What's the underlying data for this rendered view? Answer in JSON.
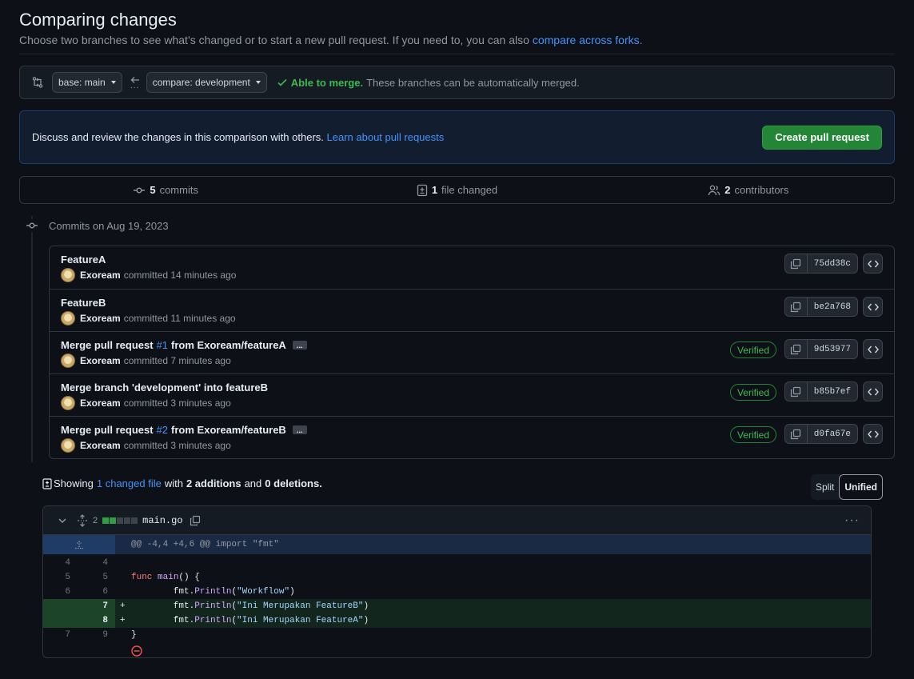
{
  "header": {
    "title": "Comparing changes",
    "subtitle": "Choose two branches to see what’s changed or to start a new pull request. If you need to, you can also",
    "subtitle_link": "compare across forks."
  },
  "range": {
    "base_label": "base: main",
    "compare_label": "compare: development",
    "merge_ok": "Able to merge.",
    "merge_desc": "These branches can be automatically merged."
  },
  "discuss": {
    "text": "Discuss and review the changes in this comparison with others.",
    "link": "Learn about pull requests",
    "button": "Create pull request"
  },
  "summary": {
    "commits_count": "5",
    "commits_label": "commits",
    "files_count": "1",
    "files_label": "file changed",
    "contributors_count": "2",
    "contributors_label": "contributors"
  },
  "timeline": {
    "date_label": "Commits on Aug 19, 2023"
  },
  "commits": [
    {
      "title": "FeatureA",
      "author": "Exoream",
      "time": "committed 14 minutes ago",
      "sha": "75dd38c",
      "verified": false
    },
    {
      "title": "FeatureB",
      "author": "Exoream",
      "time": "committed 11 minutes ago",
      "sha": "be2a768",
      "verified": false
    },
    {
      "title_pre": "Merge pull request",
      "pr": "#1",
      "title_post": "from Exoream/featureA",
      "author": "Exoream",
      "time": "committed 7 minutes ago",
      "sha": "9d53977",
      "verified": true,
      "verified_label": "Verified"
    },
    {
      "title": "Merge branch 'development' into featureB",
      "author": "Exoream",
      "time": "committed 3 minutes ago",
      "sha": "b85b7ef",
      "verified": true,
      "verified_label": "Verified"
    },
    {
      "title_pre": "Merge pull request",
      "pr": "#2",
      "title_post": "from Exoream/featureB",
      "author": "Exoream",
      "time": "committed 3 minutes ago",
      "sha": "d0fa67e",
      "verified": true,
      "verified_label": "Verified"
    }
  ],
  "showing": {
    "prefix": "Showing",
    "link": "1 changed file",
    "with": "with",
    "additions": "2 additions",
    "and": "and",
    "deletions": "0 deletions."
  },
  "view_toggle": {
    "split": "Split",
    "unified": "Unified",
    "selected": "Unified"
  },
  "diff": {
    "changes_count": "2",
    "filename": "main.go",
    "hunk": "@@ -4,4 +4,6 @@ import \"fmt\"",
    "lines": [
      {
        "old": "4",
        "new": "4",
        "sign": "",
        "type": "ctx",
        "code": ""
      },
      {
        "old": "5",
        "new": "5",
        "sign": "",
        "type": "ctx",
        "code": "func main() {"
      },
      {
        "old": "6",
        "new": "6",
        "sign": "",
        "type": "ctx",
        "code": "        fmt.Println(\"Workflow\")"
      },
      {
        "old": "",
        "new": "7",
        "sign": "+",
        "type": "add",
        "code": "        fmt.Println(\"Ini Merupakan FeatureB\")"
      },
      {
        "old": "",
        "new": "8",
        "sign": "+",
        "type": "add",
        "code": "        fmt.Println(\"Ini Merupakan FeatureA\")"
      },
      {
        "old": "7",
        "new": "9",
        "sign": "",
        "type": "ctx",
        "code": "}"
      }
    ]
  },
  "colors": {
    "accent": "#4493f8",
    "success": "#3fb950",
    "button_green": "#238636",
    "background": "#0d1117"
  }
}
